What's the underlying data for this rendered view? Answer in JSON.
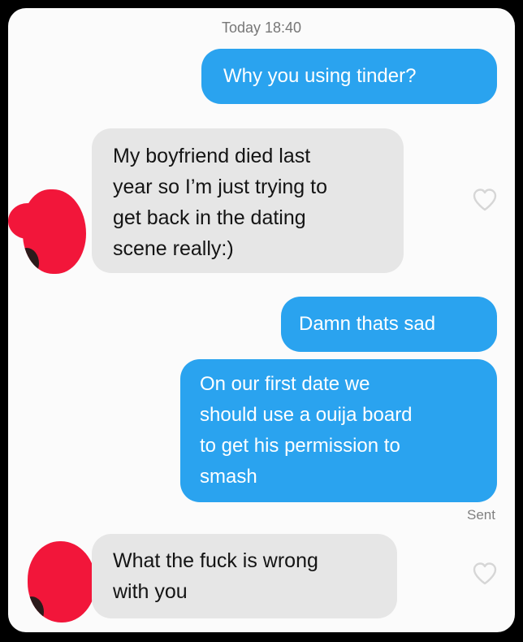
{
  "header": {
    "timestamp": "Today 18:40"
  },
  "messages": [
    {
      "direction": "outgoing",
      "lines": [
        "Why you using tinder?"
      ]
    },
    {
      "direction": "incoming",
      "lines": [
        "My boyfriend died last",
        "year so I’m just trying to",
        "get back in the dating",
        "scene really:)"
      ]
    },
    {
      "direction": "outgoing",
      "lines": [
        "Damn thats sad"
      ]
    },
    {
      "direction": "outgoing",
      "lines": [
        "On our first date we",
        "should use a ouija board",
        "to get his permission to",
        "smash"
      ]
    },
    {
      "direction": "incoming",
      "lines": [
        "What the fuck is wrong",
        "with you"
      ]
    }
  ],
  "status": {
    "sent_label": "Sent"
  },
  "icons": {
    "like": "heart-outline-icon",
    "avatar": "redacted-avatar"
  },
  "colors": {
    "outgoing_bubble": "#2aa3ef",
    "incoming_bubble": "#e6e6e6",
    "avatar_redaction": "#f2163a"
  }
}
